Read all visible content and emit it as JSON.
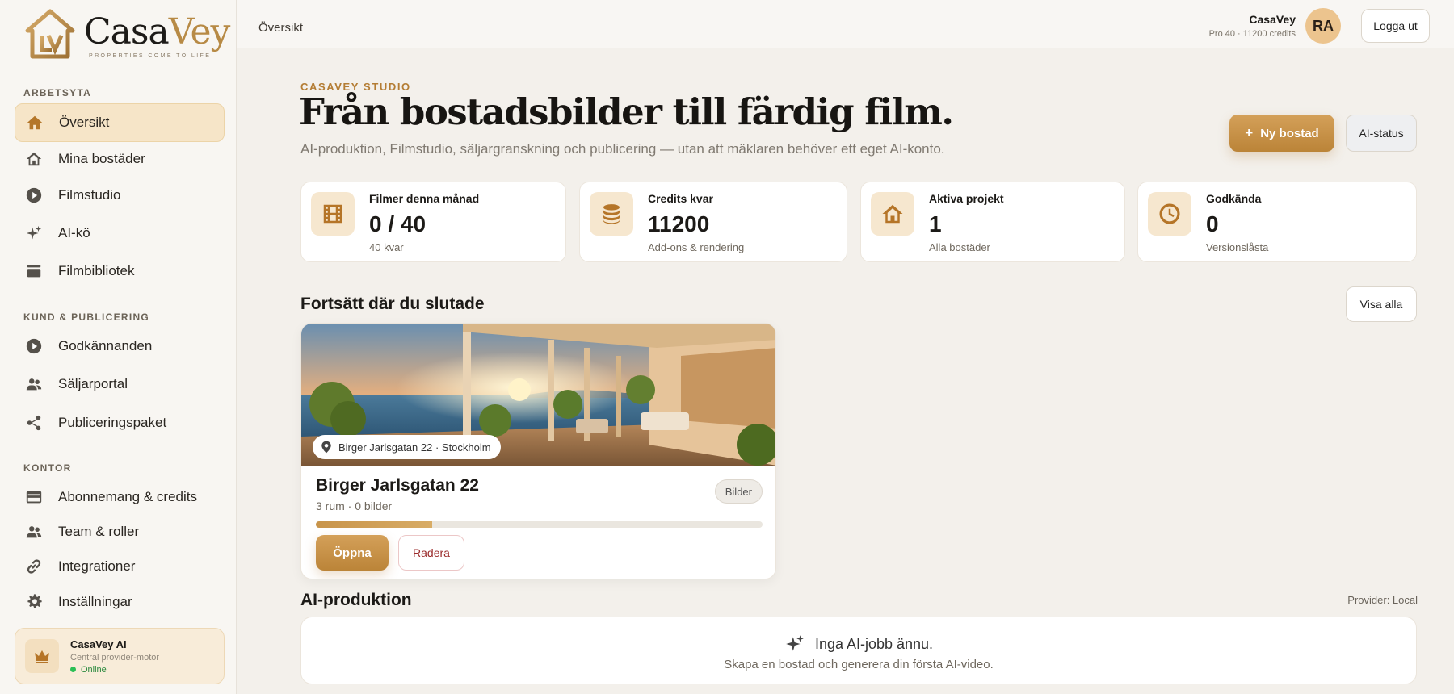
{
  "brand": {
    "name_main": "Casa",
    "name_accent": "Vey",
    "tagline": "PROPERTIES COME TO LIFE",
    "accent_color": "#b78a45"
  },
  "sidebar": {
    "sections": [
      {
        "label": "ARBETSYTA",
        "items": [
          {
            "label": "Översikt",
            "icon": "home-icon",
            "active": true
          },
          {
            "label": "Mina bostäder",
            "icon": "house-icon"
          },
          {
            "label": "Filmstudio",
            "icon": "play-circle-icon"
          },
          {
            "label": "AI-kö",
            "icon": "sparkle-icon"
          },
          {
            "label": "Filmbibliotek",
            "icon": "library-icon"
          }
        ]
      },
      {
        "label": "KUND & PUBLICERING",
        "items": [
          {
            "label": "Godkännanden",
            "icon": "play-circle-icon"
          },
          {
            "label": "Säljarportal",
            "icon": "people-icon"
          },
          {
            "label": "Publiceringspaket",
            "icon": "share-icon"
          }
        ]
      },
      {
        "label": "KONTOR",
        "items": [
          {
            "label": "Abonnemang & credits",
            "icon": "card-icon"
          },
          {
            "label": "Team & roller",
            "icon": "people-icon"
          },
          {
            "label": "Integrationer",
            "icon": "link-icon"
          },
          {
            "label": "Inställningar",
            "icon": "gear-icon"
          }
        ]
      }
    ],
    "ai_box": {
      "title": "CasaVey AI",
      "subtitle": "Central provider-motor",
      "status": "Online",
      "icon": "crown-icon"
    }
  },
  "topbar": {
    "breadcrumb": "Översikt",
    "user_name": "CasaVey",
    "user_plan": "Pro 40 · 11200 credits",
    "avatar_initials": "RA",
    "logout_label": "Logga ut"
  },
  "main": {
    "eyebrow": "CASAVEY STUDIO",
    "title": "Från bostadsbilder till färdig film.",
    "subtitle": "AI-produktion, Filmstudio, säljargranskning och publicering — utan att mäklaren behöver ett eget AI-konto.",
    "new_property_label": "Ny bostad",
    "new_property_icon": "plus-icon",
    "ai_status_label": "AI-status",
    "stats": [
      {
        "label": "Filmer denna månad",
        "value": "0 / 40",
        "sub": "40 kvar",
        "icon": "film-icon"
      },
      {
        "label": "Credits kvar",
        "value": "11200",
        "sub": "Add-ons & rendering",
        "icon": "coins-icon"
      },
      {
        "label": "Aktiva projekt",
        "value": "1",
        "sub": "Alla bostäder",
        "icon": "house-icon"
      },
      {
        "label": "Godkända",
        "value": "0",
        "sub": "Versionslåsta",
        "icon": "clock-icon"
      }
    ],
    "continue_heading": "Fortsätt där du slutade",
    "view_all_label": "Visa alla",
    "property_card": {
      "location": "Birger Jarlsgatan 22 · Stockholm",
      "title": "Birger Jarlsgatan 22",
      "meta": "3 rum · 0 bilder",
      "tag": "Bilder",
      "progress": 0.26,
      "open_label": "Öppna",
      "delete_label": "Radera"
    },
    "ai_production": {
      "heading": "AI-produktion",
      "provider": "Provider: Local",
      "empty_title": "Inga AI-jobb ännu.",
      "empty_sub": "Skapa en bostad och generera din första AI-video."
    }
  }
}
